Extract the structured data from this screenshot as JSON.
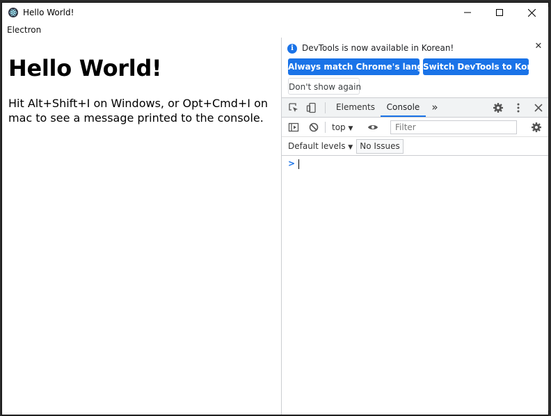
{
  "window": {
    "title": "Hello World!",
    "icon": "electron-icon",
    "controls": [
      "minimize",
      "maximize",
      "close"
    ]
  },
  "menu": {
    "items": [
      "Electron"
    ]
  },
  "page": {
    "heading": "Hello World!",
    "body": "Hit Alt+Shift+I on Windows, or Opt+Cmd+I on mac to see a message printed to the console."
  },
  "devtools": {
    "infobar": {
      "message": "DevTools is now available in Korean!",
      "match_button": "Always match Chrome's language",
      "switch_button": "Switch DevTools to Korean",
      "dismiss_button": "Don't show again",
      "close": "✕"
    },
    "tabs": [
      {
        "label": "Elements",
        "active": false
      },
      {
        "label": "Console",
        "active": true
      }
    ],
    "more_tabs": "»",
    "console": {
      "context": "top",
      "filter_placeholder": "Filter",
      "levels": "Default levels",
      "issues": "No Issues",
      "prompt": ">"
    },
    "colors": {
      "accent": "#1a73e8",
      "toolbar": "#f1f3f4"
    }
  }
}
